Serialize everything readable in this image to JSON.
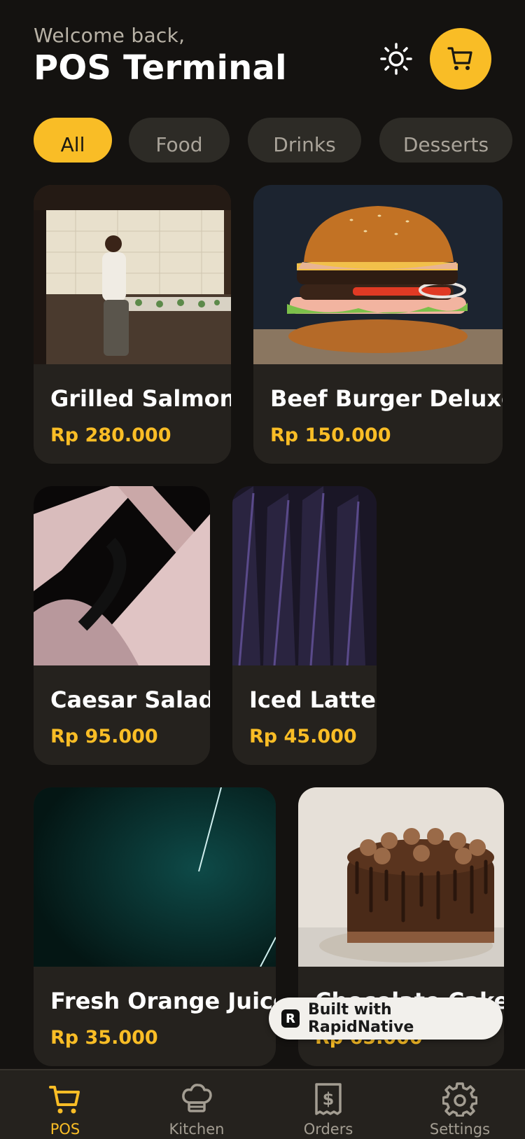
{
  "header": {
    "welcome": "Welcome back,",
    "title": "POS Terminal"
  },
  "icons": {
    "theme": "sun-icon",
    "cart": "cart-icon"
  },
  "colors": {
    "accent": "#f9bd26",
    "background": "#141210",
    "card": "#25221e"
  },
  "categories": [
    {
      "label": "All",
      "active": true
    },
    {
      "label": "Food",
      "active": false
    },
    {
      "label": "Drinks",
      "active": false
    },
    {
      "label": "Desserts",
      "active": false
    }
  ],
  "products": [
    {
      "name": "Grilled Salmon",
      "price": "Rp 280.000"
    },
    {
      "name": "Beef Burger Deluxe",
      "price": "Rp 150.000"
    },
    {
      "name": "Caesar Salad",
      "price": "Rp 95.000"
    },
    {
      "name": "Iced Latte",
      "price": "Rp 45.000"
    },
    {
      "name": "Fresh Orange Juice",
      "price": "Rp 35.000"
    },
    {
      "name": "Chocolate Cake",
      "price": "Rp 65.000"
    }
  ],
  "badge": {
    "text": "Built with RapidNative"
  },
  "nav": [
    {
      "label": "POS",
      "icon": "cart-icon",
      "active": true
    },
    {
      "label": "Kitchen",
      "icon": "chef-hat-icon",
      "active": false
    },
    {
      "label": "Orders",
      "icon": "receipt-icon",
      "active": false
    },
    {
      "label": "Settings",
      "icon": "gear-icon",
      "active": false
    }
  ]
}
